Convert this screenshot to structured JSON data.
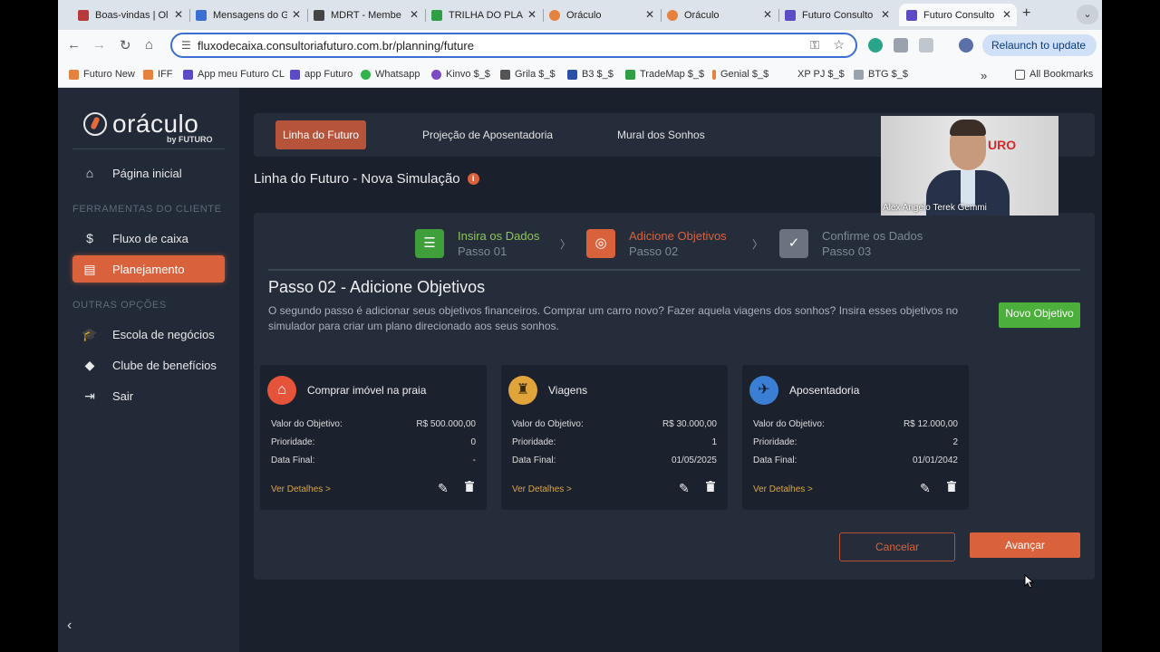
{
  "browser": {
    "tabs": [
      {
        "title": "Boas-vindas | Ol",
        "color": "#b83a3a"
      },
      {
        "title": "Mensagens do G",
        "color": "#3b6fd4"
      },
      {
        "title": "MDRT - Membe",
        "color": "#444444"
      },
      {
        "title": "TRILHA DO PLA",
        "color": "#2f9e44"
      },
      {
        "title": "Oráculo",
        "color": "#e5823e"
      },
      {
        "title": "Oráculo",
        "color": "#e5823e"
      },
      {
        "title": "Futuro Consulto",
        "color": "#5b4bc4"
      },
      {
        "title": "Futuro Consulto",
        "color": "#5b4bc4"
      }
    ],
    "url": "fluxodecaixa.consultoriafuturo.com.br/planning/future",
    "relaunch_label": "Relaunch to update",
    "bookmarks": [
      "Futuro New",
      "IFF",
      "App meu Futuro CL",
      "app Futuro",
      "Whatsapp",
      "Kinvo $_$",
      "Grila $_$",
      "B3 $_$",
      "TradeMap $_$",
      "Genial $_$",
      "XP PJ $_$",
      "BTG $_$"
    ],
    "all_bookmarks_label": "All Bookmarks"
  },
  "sidebar": {
    "logo_word": "oráculo",
    "logo_by": "by FUTURO",
    "home_label": "Página inicial",
    "section1": "FERRAMENTAS DO CLIENTE",
    "cashflow_label": "Fluxo de caixa",
    "planning_label": "Planejamento",
    "section2": "OUTRAS OPÇÕES",
    "school_label": "Escola de negócios",
    "club_label": "Clube de benefícios",
    "exit_label": "Sair"
  },
  "topnav": {
    "tab1": "Linha do Futuro",
    "tab2": "Projeção de Aposentadoria",
    "tab3": "Mural dos Sonhos"
  },
  "page_title": "Linha do Futuro - Nova Simulação",
  "video": {
    "brand": "URO",
    "caption": "Alex Angelo Terek Gemmi"
  },
  "steps": [
    {
      "title": "Insira os Dados",
      "sub": "Passo 01",
      "color": "#8fc45a"
    },
    {
      "title": "Adicione Objetivos",
      "sub": "Passo 02",
      "color": "#d9623c"
    },
    {
      "title": "Confirme os Dados",
      "sub": "Passo 03",
      "color": "#7f8896"
    }
  ],
  "section": {
    "title": "Passo 02 - Adicione Objetivos",
    "description": "O segundo passo é adicionar seus objetivos financeiros. Comprar um carro novo? Fazer aquela viagens dos sonhos? Insira esses objetivos no simulador para criar um plano direcionado aos seus sonhos.",
    "new_button": "Novo Objetivo"
  },
  "labels": {
    "value": "Valor do Objetivo:",
    "priority": "Prioridade:",
    "end_date": "Data Final:",
    "details": "Ver Detalhes >"
  },
  "objectives": [
    {
      "name": "Comprar imóvel na praia",
      "value": "R$ 500.000,00",
      "priority": "0",
      "end_date": "-",
      "icon_color": "#e5533a"
    },
    {
      "name": "Viagens",
      "value": "R$ 30.000,00",
      "priority": "1",
      "end_date": "01/05/2025",
      "icon_color": "#e0a43a"
    },
    {
      "name": "Aposentadoria",
      "value": "R$ 12.000,00",
      "priority": "2",
      "end_date": "01/01/2042",
      "icon_color": "#3b7fd4"
    }
  ],
  "buttons": {
    "cancel": "Cancelar",
    "next": "Avançar"
  }
}
